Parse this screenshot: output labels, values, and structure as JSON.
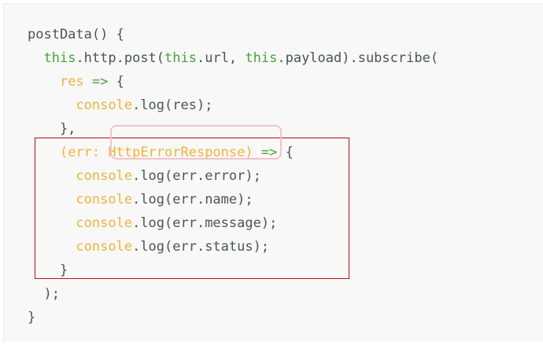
{
  "code": {
    "lines": [
      [
        {
          "t": "postData() {",
          "c": "punc"
        }
      ],
      [
        {
          "t": "  ",
          "c": "punc"
        },
        {
          "t": "this",
          "c": "kw"
        },
        {
          "t": ".http.post(",
          "c": "punc"
        },
        {
          "t": "this",
          "c": "kw"
        },
        {
          "t": ".url, ",
          "c": "punc"
        },
        {
          "t": "this",
          "c": "kw"
        },
        {
          "t": ".payload).subscribe(",
          "c": "punc"
        }
      ],
      [
        {
          "t": "    ",
          "c": "punc"
        },
        {
          "t": "res",
          "c": "id"
        },
        {
          "t": " ",
          "c": "punc"
        },
        {
          "t": "=>",
          "c": "kw"
        },
        {
          "t": " {",
          "c": "punc"
        }
      ],
      [
        {
          "t": "      ",
          "c": "punc"
        },
        {
          "t": "console",
          "c": "id"
        },
        {
          "t": ".log(res);",
          "c": "punc"
        }
      ],
      [
        {
          "t": "    },",
          "c": "punc"
        }
      ],
      [
        {
          "t": "    ",
          "c": "punc"
        },
        {
          "t": "(err: ",
          "c": "id"
        },
        {
          "t": "HttpErrorResponse",
          "c": "id"
        },
        {
          "t": ")",
          "c": "id"
        },
        {
          "t": " ",
          "c": "punc"
        },
        {
          "t": "=>",
          "c": "kw"
        },
        {
          "t": " {",
          "c": "punc"
        }
      ],
      [
        {
          "t": "      ",
          "c": "punc"
        },
        {
          "t": "console",
          "c": "id"
        },
        {
          "t": ".log(err.error);",
          "c": "punc"
        }
      ],
      [
        {
          "t": "      ",
          "c": "punc"
        },
        {
          "t": "console",
          "c": "id"
        },
        {
          "t": ".log(err.name);",
          "c": "punc"
        }
      ],
      [
        {
          "t": "      ",
          "c": "punc"
        },
        {
          "t": "console",
          "c": "id"
        },
        {
          "t": ".log(err.message);",
          "c": "punc"
        }
      ],
      [
        {
          "t": "      ",
          "c": "punc"
        },
        {
          "t": "console",
          "c": "id"
        },
        {
          "t": ".log(err.status);",
          "c": "punc"
        }
      ],
      [
        {
          "t": "    }",
          "c": "punc"
        }
      ],
      [
        {
          "t": "  );",
          "c": "punc"
        }
      ],
      [
        {
          "t": "}",
          "c": "punc"
        }
      ]
    ]
  },
  "colors": {
    "keyword": "#46a43a",
    "identifier": "#f0b33a",
    "text": "#4a5553",
    "background": "#f8f8f8",
    "error_block_border": "#b80b16",
    "type_highlight_border": "#f3c2cb"
  }
}
